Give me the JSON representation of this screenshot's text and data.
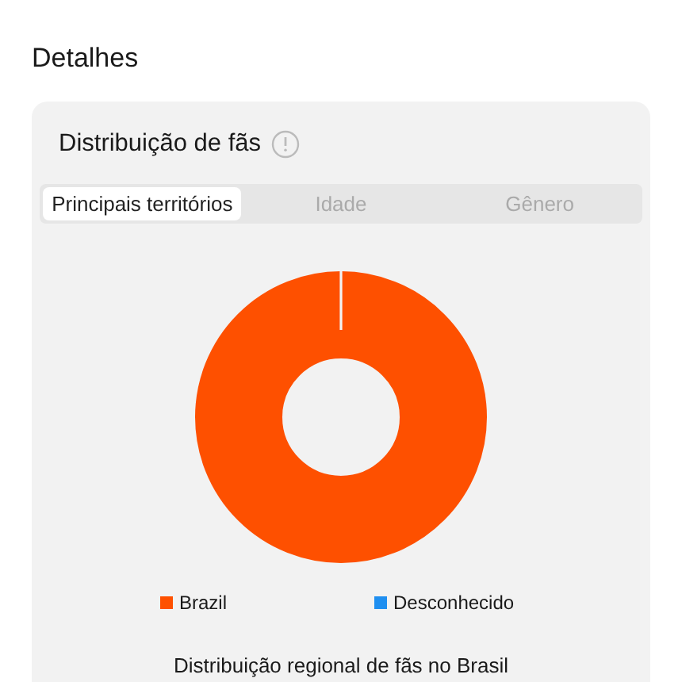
{
  "heading": "Detalhes",
  "card": {
    "title": "Distribuição de fãs",
    "tabs": [
      {
        "label": "Principais territórios",
        "selected": true
      },
      {
        "label": "Idade",
        "selected": false
      },
      {
        "label": "Gênero",
        "selected": false
      }
    ],
    "legend": [
      {
        "label": "Brazil",
        "color": "#fe5000"
      },
      {
        "label": "Desconhecido",
        "color": "#1f8ff0"
      }
    ],
    "subtitle": "Distribuição regional de fãs no Brasil"
  }
}
